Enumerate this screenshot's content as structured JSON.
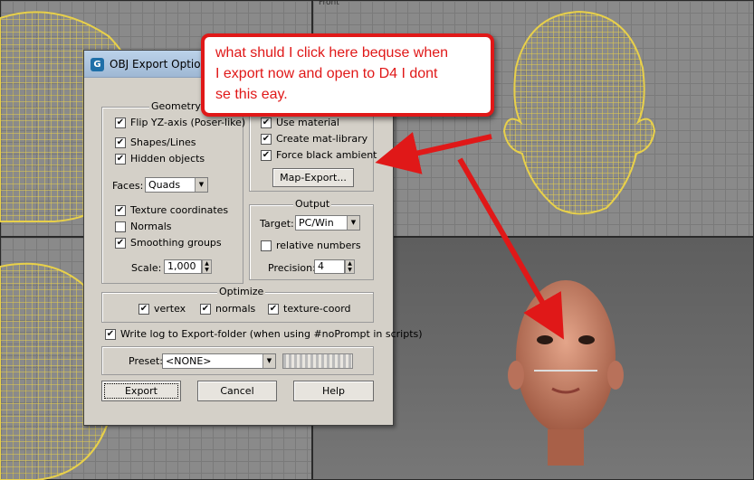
{
  "viewports": {
    "top_label": "Front"
  },
  "dialog": {
    "title": "OBJ Export Options",
    "geometry": {
      "legend": "Geometry",
      "flip_yz": "Flip YZ-axis (Poser-like)",
      "shapes_lines": "Shapes/Lines",
      "hidden_objects": "Hidden objects",
      "faces_label": "Faces:",
      "faces_value": "Quads",
      "texture_coordinates": "Texture coordinates",
      "normals": "Normals",
      "smoothing_groups": "Smoothing groups",
      "scale_label": "Scale:",
      "scale_value": "1,000"
    },
    "material": {
      "use_material": "Use material",
      "create_mat_library": "Create mat-library",
      "force_black_ambient": "Force black ambient",
      "map_export": "Map-Export..."
    },
    "output": {
      "legend": "Output",
      "target_label": "Target:",
      "target_value": "PC/Win",
      "relative_numbers": "relative numbers",
      "precision_label": "Precision:",
      "precision_value": "4"
    },
    "optimize": {
      "legend": "Optimize",
      "vertex": "vertex",
      "normals": "normals",
      "texture_coord": "texture-coord"
    },
    "write_log": "Write log to Export-folder (when using #noPrompt in scripts)",
    "preset_label": "Preset:",
    "preset_value": "<NONE>",
    "buttons": {
      "export": "Export",
      "cancel": "Cancel",
      "help": "Help"
    },
    "checks": {
      "flip_yz": "✔",
      "shapes_lines": "✔",
      "hidden_objects": "✔",
      "texture_coordinates": "✔",
      "normals": "",
      "smoothing_groups": "✔",
      "use_material": "✔",
      "create_mat_library": "✔",
      "force_black_ambient": "✔",
      "relative_numbers": "",
      "vertex": "✔",
      "opt_normals": "✔",
      "texture_coord": "✔",
      "write_log": "✔"
    }
  },
  "callout": {
    "line1": "what shuld I click here bequse when",
    "line2": "I export now and open to D4 I dont",
    "line3": "se this eay."
  },
  "colors": {
    "wireframe": "#e8d04a",
    "annotation": "#e01818",
    "dialog_bg": "#d4d0c8"
  }
}
